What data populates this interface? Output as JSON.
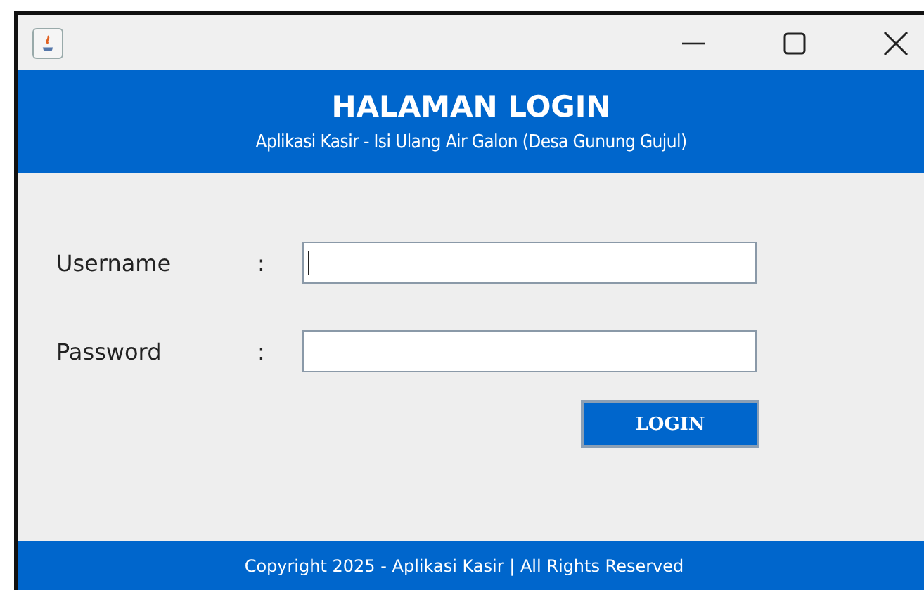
{
  "header": {
    "title": "HALAMAN LOGIN",
    "subtitle": "Aplikasi Kasir - Isi Ulang Air Galon (Desa Gunung Gujul)"
  },
  "form": {
    "fields": [
      {
        "label": "Username",
        "separator": ":",
        "focused": true
      },
      {
        "label": "Password",
        "separator": ":",
        "focused": false
      }
    ],
    "button": "LOGIN"
  },
  "footer": "Copyright 2025 - Aplikasi Kasir | All Rights Reserved"
}
